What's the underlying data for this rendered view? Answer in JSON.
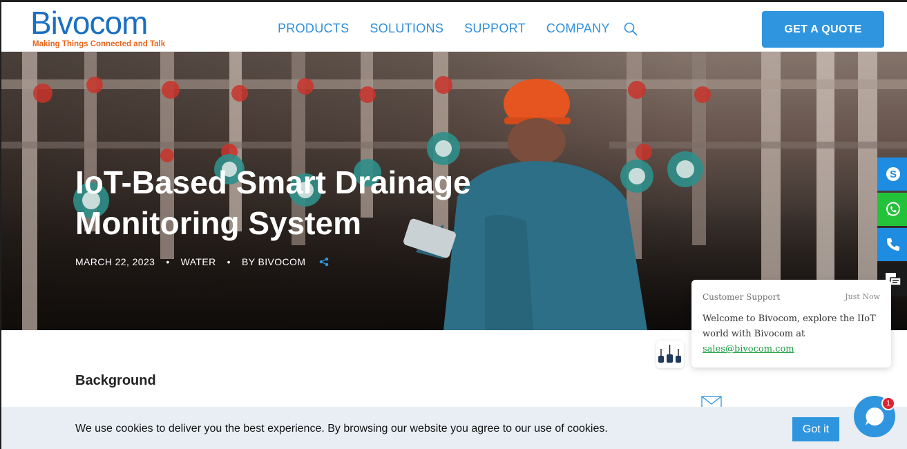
{
  "brand": {
    "name": "Bivocom",
    "tagline": "Making Things Connected and Talk",
    "primary_color": "#2f95de",
    "logo_color": "#1a6fc2",
    "tagline_color": "#e8641c"
  },
  "nav": {
    "items": [
      "PRODUCTS",
      "SOLUTIONS",
      "SUPPORT",
      "COMPANY"
    ],
    "search_icon": "search-icon",
    "cta": "GET A QUOTE"
  },
  "hero": {
    "title": "IoT-Based Smart Drainage Monitoring System",
    "date": "MARCH 22, 2023",
    "category": "WATER",
    "author": "BY BIVOCOM",
    "separator": "•",
    "share_icon": "share-icon"
  },
  "content": {
    "section_title": "Background"
  },
  "side_contacts": [
    {
      "name": "skype-icon",
      "color": "#1e8ce0"
    },
    {
      "name": "whatsapp-icon",
      "color": "#24c23a"
    },
    {
      "name": "phone-icon",
      "color": "#1e8ce0"
    },
    {
      "name": "chat-icon",
      "color": "#1a1a1a"
    }
  ],
  "chat": {
    "from": "Customer Support",
    "time": "Just Now",
    "message": "Welcome to Bivocom, explore the IIoT world with Bivocom at",
    "email": "sales@bivocom.com",
    "unread_count": "1"
  },
  "cookie": {
    "text": "We use cookies to deliver you the best experience. By browsing our website you agree to our use of cookies.",
    "button": "Got it"
  }
}
